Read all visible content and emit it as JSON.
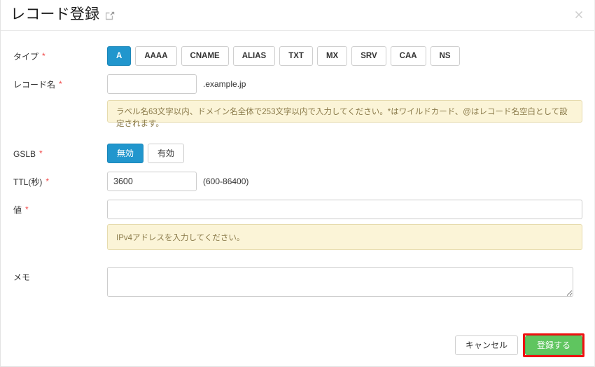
{
  "header": {
    "title": "レコード登録",
    "external_link_icon": "external-link-icon",
    "close_icon": "close-icon"
  },
  "form": {
    "type": {
      "label": "タイプ",
      "required": "*",
      "options": [
        "A",
        "AAAA",
        "CNAME",
        "ALIAS",
        "TXT",
        "MX",
        "SRV",
        "CAA",
        "NS"
      ],
      "selected": "A"
    },
    "record_name": {
      "label": "レコード名",
      "required": "*",
      "value": "",
      "placeholder": "",
      "suffix": ".example.jp",
      "notice": "ラベル名63文字以内、ドメイン名全体で253文字以内で入力してください。*はワイルドカード、@はレコード名空白として設定されます。"
    },
    "gslb": {
      "label": "GSLB",
      "required": "*",
      "options": [
        "無効",
        "有効"
      ],
      "selected": "無効"
    },
    "ttl": {
      "label": "TTL(秒)",
      "required": "*",
      "value": "3600",
      "placeholder": "",
      "hint": "(600-86400)"
    },
    "value": {
      "label": "値",
      "required": "*",
      "value": "",
      "placeholder": "",
      "notice": "IPv4アドレスを入力してください。"
    },
    "memo": {
      "label": "メモ",
      "value": "",
      "placeholder": ""
    }
  },
  "footer": {
    "cancel_label": "キャンセル",
    "submit_label": "登録する"
  },
  "colors": {
    "accent_blue": "#2196cd",
    "submit_green": "#5fc55f",
    "highlight_red": "#ee1111",
    "notice_bg": "#fbf4d7",
    "notice_border": "#e6dbae",
    "notice_text": "#8a7a4a",
    "required_red": "#f04b4b"
  }
}
